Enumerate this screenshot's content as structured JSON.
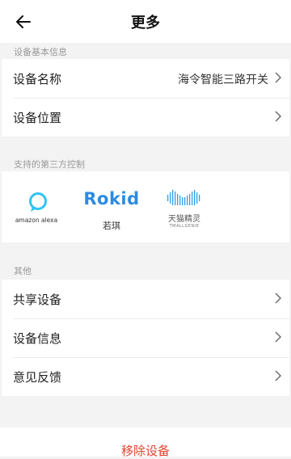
{
  "header": {
    "title": "更多"
  },
  "basic_info": {
    "section_title": "设备基本信息",
    "device_name_label": "设备名称",
    "device_name_value": "海令智能三路开关",
    "device_location_label": "设备位置"
  },
  "third_party": {
    "section_title": "支持的第三方控制",
    "brands": [
      {
        "name": "amazon alexa",
        "icon": "alexa-icon"
      },
      {
        "logo_text": "Rokid",
        "name": "若琪",
        "icon": "rokid-logo"
      },
      {
        "name": "天猫精灵",
        "subname": "TMALLGENIE",
        "icon": "tmall-genie-logo"
      }
    ]
  },
  "others": {
    "section_title": "其他",
    "items": [
      {
        "label": "共享设备"
      },
      {
        "label": "设备信息"
      },
      {
        "label": "意见反馈"
      }
    ]
  },
  "footer": {
    "remove_label": "移除设备"
  },
  "colors": {
    "rokid_blue": "#2d8be0",
    "alexa_blue": "#31c4f3",
    "tmall_blue": "#2f9fe6",
    "danger": "#e4432d"
  }
}
